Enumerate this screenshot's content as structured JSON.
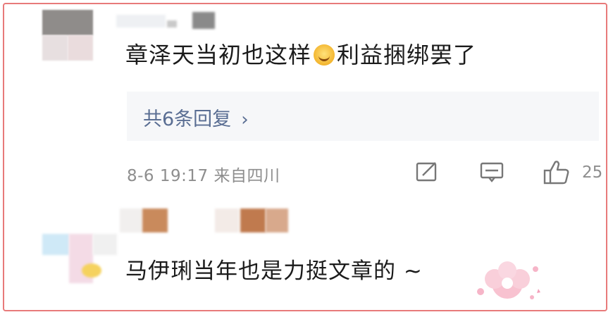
{
  "comments": [
    {
      "text_before_emoji": "章泽天当初也这样",
      "emoji": "grin-emoji",
      "text_after_emoji": "利益捆绑罢了",
      "reply_summary": "共6条回复",
      "reply_chevron": "›",
      "meta": "8-6 19:17 来自四川",
      "actions": [
        "share-icon",
        "comment-icon",
        "like-icon"
      ],
      "like_count": "25"
    },
    {
      "text": "马伊琍当年也是力挺文章的 ~",
      "sticker": "pink-flower-sticker"
    }
  ],
  "colors": {
    "frame": "#e87a7a",
    "text": "#1b1b1b",
    "link": "#5a6e93",
    "meta": "#8e8e8e",
    "reply_bg": "#f6f7f9"
  }
}
